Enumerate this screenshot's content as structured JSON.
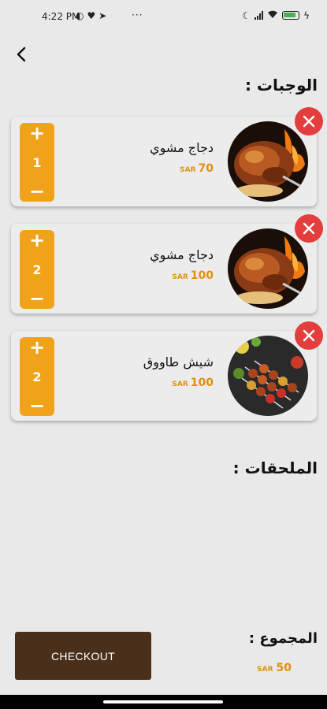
{
  "status_bar": {
    "time": "4:22 PM",
    "overflow": "···"
  },
  "sections": {
    "meals_title": "الوجبات :",
    "addons_title": "الملحقات :"
  },
  "items": [
    {
      "name": "دجاج مشوي",
      "price": "70",
      "currency": "SAR",
      "quantity": "1",
      "image": "grilled-chicken-photo"
    },
    {
      "name": "دجاج مشوي",
      "price": "100",
      "currency": "SAR",
      "quantity": "2",
      "image": "grilled-chicken-photo"
    },
    {
      "name": "شيش طاووق",
      "price": "100",
      "currency": "SAR",
      "quantity": "2",
      "image": "shish-tawook-photo"
    }
  ],
  "stepper": {
    "plus": "+",
    "minus": "−"
  },
  "footer": {
    "total_label": "المجموع :",
    "total_value": "50",
    "currency": "SAR",
    "checkout_label": "CHECKOUT"
  },
  "colors": {
    "accent": "#f0a21a",
    "price": "#e1900d",
    "remove": "#e43d3d",
    "checkout": "#4a2f1a"
  }
}
